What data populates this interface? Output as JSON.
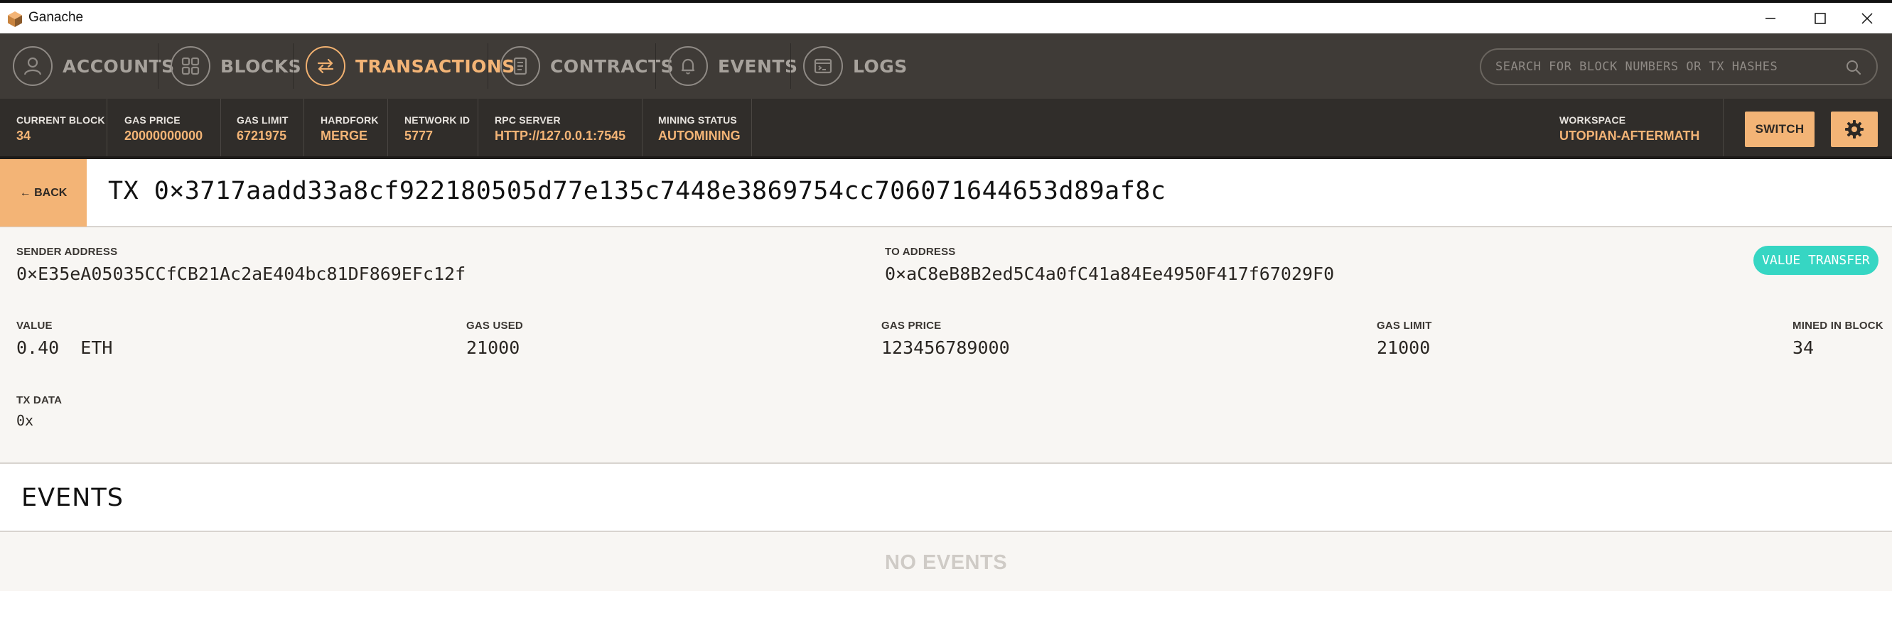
{
  "window": {
    "title": "Ganache"
  },
  "nav": {
    "items": [
      {
        "label": "ACCOUNTS",
        "icon": "person-icon",
        "active": false
      },
      {
        "label": "BLOCKS",
        "icon": "grid-icon",
        "active": false
      },
      {
        "label": "TRANSACTIONS",
        "icon": "swap-arrows-icon",
        "active": true
      },
      {
        "label": "CONTRACTS",
        "icon": "document-icon",
        "active": false
      },
      {
        "label": "EVENTS",
        "icon": "bell-icon",
        "active": false
      },
      {
        "label": "LOGS",
        "icon": "terminal-icon",
        "active": false
      }
    ],
    "search_placeholder": "SEARCH FOR BLOCK NUMBERS OR TX HASHES"
  },
  "status": {
    "current_block_label": "CURRENT BLOCK",
    "current_block": "34",
    "gas_price_label": "GAS PRICE",
    "gas_price": "20000000000",
    "gas_limit_label": "GAS LIMIT",
    "gas_limit": "6721975",
    "hardfork_label": "HARDFORK",
    "hardfork": "MERGE",
    "network_id_label": "NETWORK ID",
    "network_id": "5777",
    "rpc_server_label": "RPC SERVER",
    "rpc_server": "HTTP://127.0.0.1:7545",
    "mining_status_label": "MINING STATUS",
    "mining_status": "AUTOMINING",
    "workspace_label": "WORKSPACE",
    "workspace": "UTOPIAN-AFTERMATH",
    "switch_label": "SWITCH"
  },
  "tx": {
    "back_label": "← BACK",
    "title": "TX 0×3717aadd33a8cf922180505d77e135c7448e3869754cc706071644653d89af8c",
    "sender_label": "SENDER ADDRESS",
    "sender": "0×E35eA05035CCfCB21Ac2aE404bc81DF869EFc12f",
    "to_label": "TO ADDRESS",
    "to": "0×aC8eB8B2ed5C4a0fC41a84Ee4950F417f67029F0",
    "type_badge": "VALUE TRANSFER",
    "value_label": "VALUE",
    "value": "0.40  ETH",
    "gas_used_label": "GAS USED",
    "gas_used": "21000",
    "gas_price_label": "GAS PRICE",
    "gas_price": "123456789000",
    "gas_limit_label": "GAS LIMIT",
    "gas_limit": "21000",
    "mined_label": "MINED IN BLOCK",
    "mined": "34",
    "data_label": "TX DATA",
    "data": "0x"
  },
  "events": {
    "title": "EVENTS",
    "empty_text": "NO EVENTS"
  },
  "colors": {
    "accent": "#f3b476",
    "nav_bg": "#3f3b37",
    "status_bg": "#302d2a",
    "badge": "#36d6c3"
  }
}
